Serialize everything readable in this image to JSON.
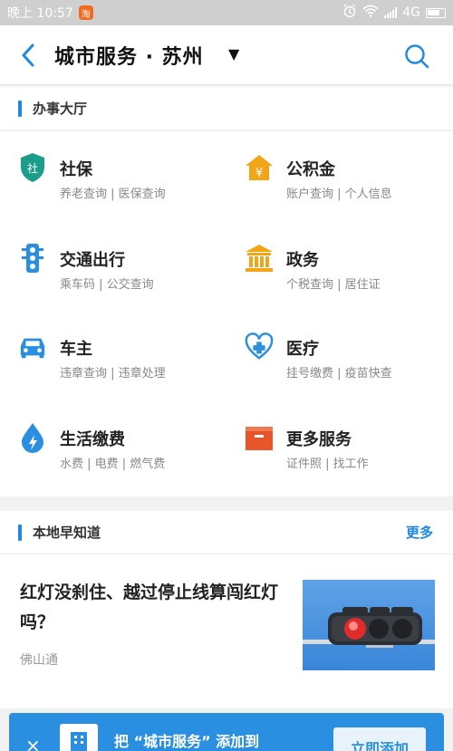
{
  "status_bar": {
    "time": "晚上 10:57",
    "network": "4G",
    "notif_badge": "淘"
  },
  "header": {
    "title": "城市服务 · 苏州",
    "caret": "▼"
  },
  "hall": {
    "title": "办事大厅",
    "services": [
      {
        "title": "社保",
        "subtitle": "养老查询 | 医保查询",
        "icon": "shield-icon",
        "icon_char": "社",
        "color": "#1a9e8a"
      },
      {
        "title": "公积金",
        "subtitle": "账户查询 | 个人信息",
        "icon": "house-yen-icon",
        "icon_char": "¥",
        "color": "#f2a516"
      },
      {
        "title": "交通出行",
        "subtitle": "乘车码 | 公交查询",
        "icon": "traffic-light-icon",
        "color": "#2a8fe0"
      },
      {
        "title": "政务",
        "subtitle": "个税查询 | 居住证",
        "icon": "government-building-icon",
        "color": "#f2a516"
      },
      {
        "title": "车主",
        "subtitle": "违章查询 | 违章处理",
        "icon": "car-icon",
        "color": "#2a8fe0"
      },
      {
        "title": "医疗",
        "subtitle": "挂号缴费 | 疫苗快查",
        "icon": "medical-heart-icon",
        "color": "#2a8fe0"
      },
      {
        "title": "生活缴费",
        "subtitle": "水费 | 电费 | 燃气费",
        "icon": "lightning-drop-icon",
        "color": "#2a8fe0"
      },
      {
        "title": "更多服务",
        "subtitle": "证件照 | 找工作",
        "icon": "box-icon",
        "color": "#e8552b"
      }
    ]
  },
  "local": {
    "title": "本地早知道",
    "more": "更多",
    "article": {
      "title": "红灯没刹住、越过停止线算闯红灯吗？",
      "source": "佛山通"
    }
  },
  "banner": {
    "close": "×",
    "text": "把 “城市服务” 添加到",
    "button": "立即添加"
  }
}
